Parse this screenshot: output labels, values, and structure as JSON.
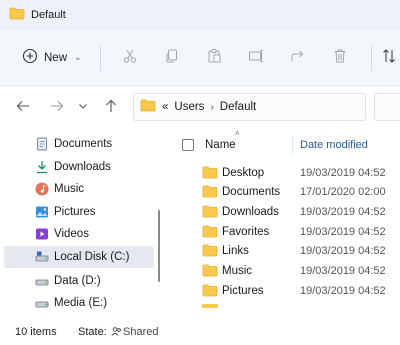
{
  "window": {
    "title": "Default"
  },
  "toolbar": {
    "new_label": "New",
    "buttons": [
      "cut-icon",
      "copy-icon",
      "paste-icon",
      "rename-icon",
      "share-icon",
      "delete-icon",
      "sort-icon"
    ]
  },
  "address": {
    "overflow": "«",
    "crumbs": [
      "Users",
      "Default"
    ]
  },
  "sidebar": {
    "items": [
      {
        "label": "Documents",
        "icon": "documents-icon"
      },
      {
        "label": "Downloads",
        "icon": "downloads-icon"
      },
      {
        "label": "Music",
        "icon": "music-icon"
      },
      {
        "label": "Pictures",
        "icon": "pictures-icon"
      },
      {
        "label": "Videos",
        "icon": "videos-icon"
      },
      {
        "label": "Local Disk (C:)",
        "icon": "drive-icon",
        "selected": true
      },
      {
        "label": "Data (D:)",
        "icon": "drive-icon"
      },
      {
        "label": "Media (E:)",
        "icon": "drive-icon"
      }
    ]
  },
  "content": {
    "columns": {
      "name": "Name",
      "date": "Date modified"
    },
    "rows": [
      {
        "name": "Desktop",
        "date": "19/03/2019 04:52"
      },
      {
        "name": "Documents",
        "date": "17/01/2020 02:00"
      },
      {
        "name": "Downloads",
        "date": "19/03/2019 04:52"
      },
      {
        "name": "Favorites",
        "date": "19/03/2019 04:52"
      },
      {
        "name": "Links",
        "date": "19/03/2019 04:52"
      },
      {
        "name": "Music",
        "date": "19/03/2019 04:52"
      },
      {
        "name": "Pictures",
        "date": "19/03/2019 04:52"
      }
    ]
  },
  "status": {
    "items": "10 items",
    "state_label": "State:",
    "shared": "Shared"
  },
  "colors": {
    "folder": "#f8c94c",
    "folder_dark": "#e6ae2e",
    "accent": "#0a64c8"
  }
}
